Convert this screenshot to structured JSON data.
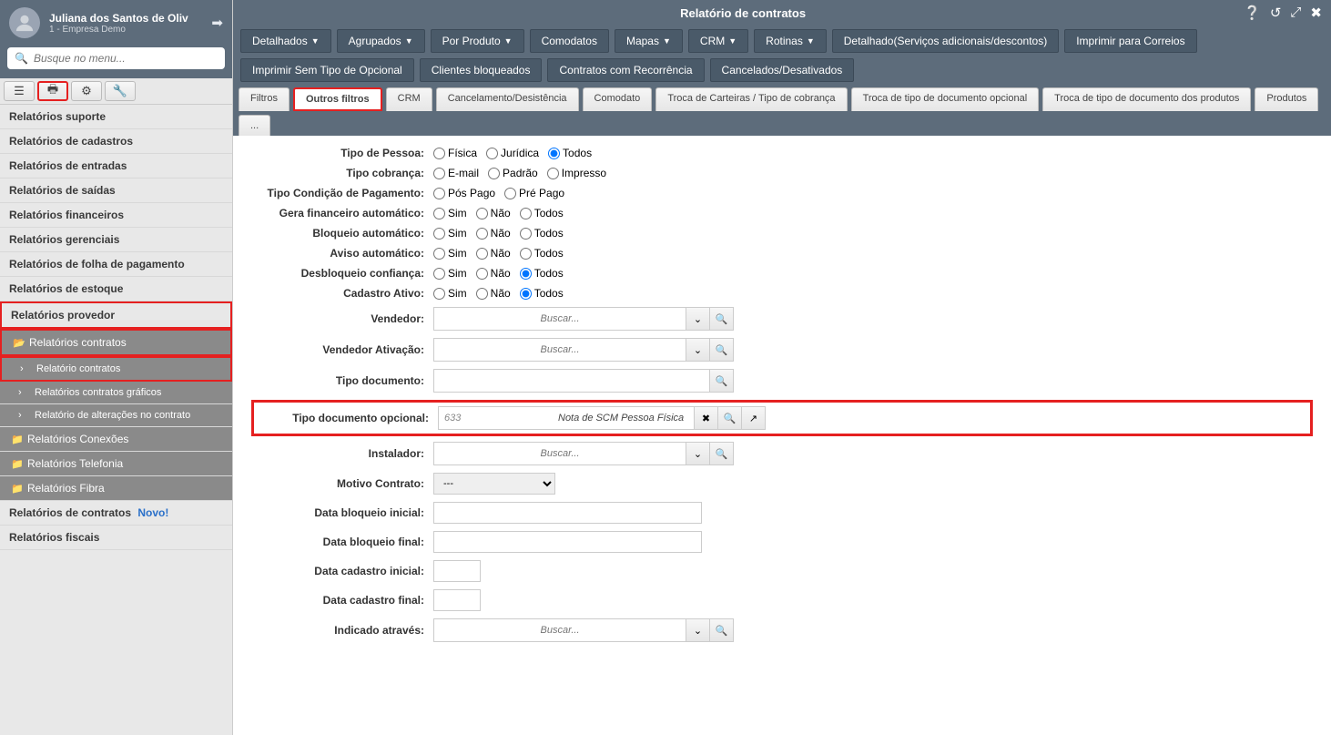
{
  "user": {
    "name": "Juliana dos Santos de Oliv",
    "company": "1 - Empresa Demo"
  },
  "search_placeholder": "Busque no menu...",
  "nav": {
    "items": [
      "Relatórios suporte",
      "Relatórios de cadastros",
      "Relatórios de entradas",
      "Relatórios de saídas",
      "Relatórios financeiros",
      "Relatórios gerenciais",
      "Relatórios de folha de pagamento",
      "Relatórios de estoque",
      "Relatórios provedor"
    ],
    "expanded": {
      "parent": "Relatórios contratos",
      "children": [
        "Relatório contratos",
        "Relatórios contratos gráficos",
        "Relatório de alterações no contrato"
      ]
    },
    "after": [
      "Relatórios Conexões",
      "Relatórios Telefonia",
      "Relatórios Fibra"
    ],
    "bottom1": {
      "label": "Relatórios de contratos",
      "badge": "Novo!"
    },
    "bottom2": "Relatórios fiscais"
  },
  "page_title": "Relatório de contratos",
  "actions": [
    {
      "label": "Detalhados",
      "caret": true
    },
    {
      "label": "Agrupados",
      "caret": true
    },
    {
      "label": "Por Produto",
      "caret": true
    },
    {
      "label": "Comodatos",
      "caret": false
    },
    {
      "label": "Mapas",
      "caret": true
    },
    {
      "label": "CRM",
      "caret": true
    },
    {
      "label": "Rotinas",
      "caret": true
    },
    {
      "label": "Detalhado(Serviços adicionais/descontos)",
      "caret": false
    },
    {
      "label": "Imprimir para Correios",
      "caret": false
    },
    {
      "label": "Imprimir Sem Tipo de Opcional",
      "caret": false
    },
    {
      "label": "Clientes bloqueados",
      "caret": false
    },
    {
      "label": "Contratos com Recorrência",
      "caret": false
    },
    {
      "label": "Cancelados/Desativados",
      "caret": false
    }
  ],
  "tabs": [
    "Filtros",
    "Outros filtros",
    "CRM",
    "Cancelamento/Desistência",
    "Comodato",
    "Troca de Carteiras / Tipo de cobrança",
    "Troca de tipo de documento opcional",
    "Troca de tipo de documento dos produtos",
    "Produtos",
    "..."
  ],
  "form": {
    "tipo_pessoa": {
      "label": "Tipo de Pessoa:",
      "opts": [
        "Física",
        "Jurídica",
        "Todos"
      ],
      "sel": 2
    },
    "tipo_cobranca": {
      "label": "Tipo cobrança:",
      "opts": [
        "E-mail",
        "Padrão",
        "Impresso"
      ],
      "sel": -1
    },
    "tipo_cond": {
      "label": "Tipo Condição de Pagamento:",
      "opts": [
        "Pós Pago",
        "Pré Pago"
      ],
      "sel": -1
    },
    "gera_fin": {
      "label": "Gera financeiro automático:",
      "opts": [
        "Sim",
        "Não",
        "Todos"
      ],
      "sel": -1
    },
    "bloq_auto": {
      "label": "Bloqueio automático:",
      "opts": [
        "Sim",
        "Não",
        "Todos"
      ],
      "sel": -1
    },
    "aviso_auto": {
      "label": "Aviso automático:",
      "opts": [
        "Sim",
        "Não",
        "Todos"
      ],
      "sel": -1
    },
    "desbloq": {
      "label": "Desbloqueio confiança:",
      "opts": [
        "Sim",
        "Não",
        "Todos"
      ],
      "sel": 2
    },
    "cad_ativo": {
      "label": "Cadastro Ativo:",
      "opts": [
        "Sim",
        "Não",
        "Todos"
      ],
      "sel": 2
    },
    "vendedor": {
      "label": "Vendedor:",
      "placeholder": "Buscar..."
    },
    "vend_ativ": {
      "label": "Vendedor Ativação:",
      "placeholder": "Buscar..."
    },
    "tipo_doc": {
      "label": "Tipo documento:"
    },
    "tipo_doc_opc": {
      "label": "Tipo documento opcional:",
      "id": "633",
      "desc": "Nota de SCM Pessoa Física  (Só Fiscal)"
    },
    "instalador": {
      "label": "Instalador:",
      "placeholder": "Buscar..."
    },
    "motivo": {
      "label": "Motivo Contrato:",
      "value": "---"
    },
    "data_bloq_ini": {
      "label": "Data bloqueio inicial:"
    },
    "data_bloq_fim": {
      "label": "Data bloqueio final:"
    },
    "data_cad_ini": {
      "label": "Data cadastro inicial:"
    },
    "data_cad_fim": {
      "label": "Data cadastro final:"
    },
    "indicado": {
      "label": "Indicado através:",
      "placeholder": "Buscar..."
    }
  }
}
